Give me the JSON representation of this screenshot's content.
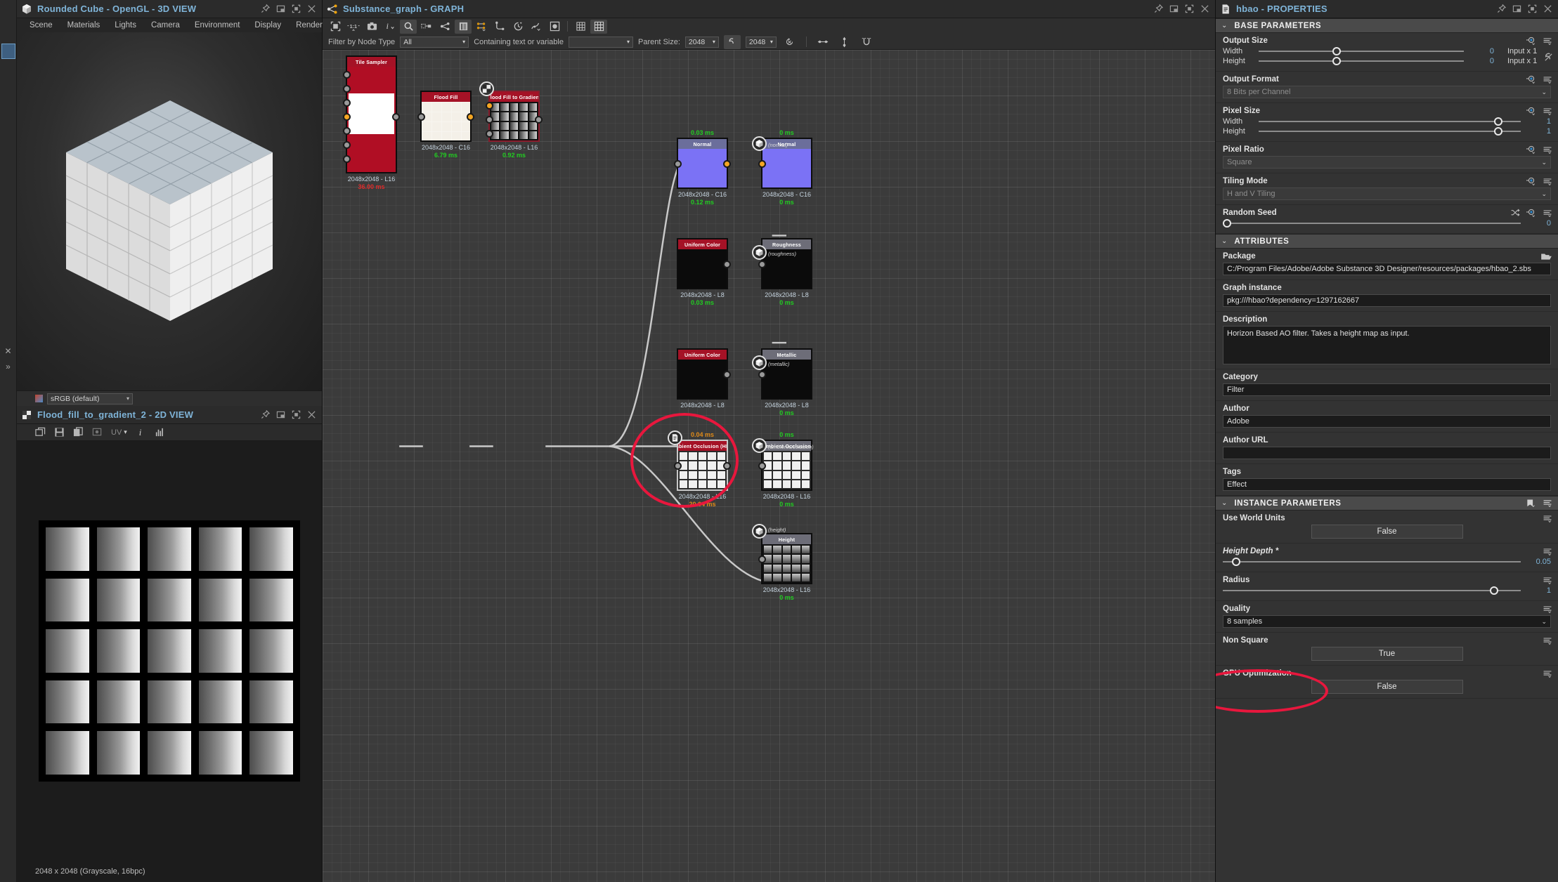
{
  "window": {
    "view3d": {
      "title": "Rounded Cube - OpenGL - 3D VIEW",
      "menu": [
        "Scene",
        "Materials",
        "Lights",
        "Camera",
        "Environment",
        "Display",
        "Renderer"
      ],
      "colorspace": "sRGB (default)"
    },
    "view2d": {
      "title": "Flood_fill_to_gradient_2 - 2D VIEW",
      "uv_label": "UV",
      "status": "2048 x 2048 (Grayscale, 16bpc)"
    },
    "graph": {
      "title": "Substance_graph - GRAPH",
      "filter": {
        "node_type_label": "Filter by Node Type",
        "node_type_value": "All",
        "containing_label": "Containing text or variable",
        "containing_value": "",
        "parent_size_label": "Parent Size:",
        "parent_size_value": "2048",
        "size_value": "2048"
      }
    },
    "properties": {
      "title": "hbao - PROPERTIES"
    }
  },
  "graph_nodes": [
    {
      "name": "Tile Sampler",
      "head": "red",
      "caption": "2048x2048 - L16",
      "time": "36.00 ms",
      "time_color": "red"
    },
    {
      "name": "Flood Fill",
      "head": "red",
      "caption": "2048x2048 - C16",
      "time": "6.79 ms",
      "time_color": "green"
    },
    {
      "name": "Flood Fill to Gradient",
      "head": "red",
      "caption": "2048x2048 - L16",
      "time": "0.92 ms",
      "time_color": "green"
    },
    {
      "name": "Normal",
      "head": "blue",
      "caption": "2048x2048 - C16",
      "time": "0.12 ms",
      "time_color": "green",
      "above": "0.03 ms"
    },
    {
      "name": "Normal",
      "head": "blue",
      "caption": "2048x2048 - C16",
      "time": "0 ms",
      "time_color": "green",
      "above": "0 ms",
      "output": "(normal)"
    },
    {
      "name": "Uniform Color",
      "head": "red",
      "caption": "2048x2048 - L8",
      "time": "0.03 ms",
      "time_color": "green"
    },
    {
      "name": "Roughness",
      "head": "gray",
      "caption": "2048x2048 - L8",
      "time": "0 ms",
      "time_color": "green",
      "output": "(roughness)"
    },
    {
      "name": "Uniform Color",
      "head": "red",
      "caption": "2048x2048 - L8",
      "time": "",
      "time_color": "green"
    },
    {
      "name": "Metallic",
      "head": "gray",
      "caption": "2048x2048 - L8",
      "time": "0 ms",
      "time_color": "green",
      "output": "(metallic)"
    },
    {
      "name": "Ambient Occlusion (HB...",
      "head": "red",
      "caption": "2048x2048 - L16",
      "time": "20.04 ms",
      "time_color": "orange",
      "above": "0.04 ms"
    },
    {
      "name": "Ambient Occlusion",
      "head": "gray",
      "caption": "2048x2048 - L16",
      "time": "0 ms",
      "time_color": "green",
      "output": "(ambientOcclusion)"
    },
    {
      "name": "Height",
      "head": "gray",
      "caption": "2048x2048 - L16",
      "time": "0 ms",
      "time_color": "green",
      "output": "(height)"
    }
  ],
  "properties": {
    "base_parameters": {
      "section": "BASE PARAMETERS",
      "output_size": {
        "label": "Output Size",
        "width_label": "Width",
        "height_label": "Height",
        "width_value": "0",
        "height_value": "0",
        "width_mode": "Input x 1",
        "height_mode": "Input x 1"
      },
      "output_format": {
        "label": "Output Format",
        "value": "8 Bits per Channel"
      },
      "pixel_size": {
        "label": "Pixel Size",
        "width_label": "Width",
        "height_label": "Height",
        "width_value": "1",
        "height_value": "1"
      },
      "pixel_ratio": {
        "label": "Pixel Ratio",
        "value": "Square"
      },
      "tiling_mode": {
        "label": "Tiling Mode",
        "value": "H and V Tiling"
      },
      "random_seed": {
        "label": "Random Seed",
        "value": "0"
      }
    },
    "attributes": {
      "section": "ATTRIBUTES",
      "package": {
        "label": "Package",
        "value": "C:/Program Files/Adobe/Adobe Substance 3D Designer/resources/packages/hbao_2.sbs"
      },
      "graph_instance": {
        "label": "Graph instance",
        "value": "pkg:///hbao?dependency=1297162667"
      },
      "description": {
        "label": "Description",
        "value": "Horizon Based AO filter. Takes a height map as input."
      },
      "category": {
        "label": "Category",
        "value": "Filter"
      },
      "author": {
        "label": "Author",
        "value": "Adobe"
      },
      "author_url": {
        "label": "Author URL",
        "value": ""
      },
      "tags": {
        "label": "Tags",
        "value": "Effect"
      }
    },
    "instance_parameters": {
      "section": "INSTANCE PARAMETERS",
      "use_world_units": {
        "label": "Use World Units",
        "value": "False"
      },
      "height_depth": {
        "label": "Height Depth *",
        "value": "0.05"
      },
      "radius": {
        "label": "Radius",
        "value": "1"
      },
      "quality": {
        "label": "Quality",
        "value": "8 samples"
      },
      "non_square": {
        "label": "Non Square",
        "value": "True"
      },
      "gpu_optimization": {
        "label": "GPU Optimization",
        "value": "False"
      }
    }
  },
  "colors": {
    "accent_blue": "#7fb4d8",
    "annotation_red": "#e8173d",
    "node_red": "#a51226",
    "node_blue": "#6b6e9b",
    "orange_link": "#f5a623",
    "time_green": "#22cc22"
  }
}
